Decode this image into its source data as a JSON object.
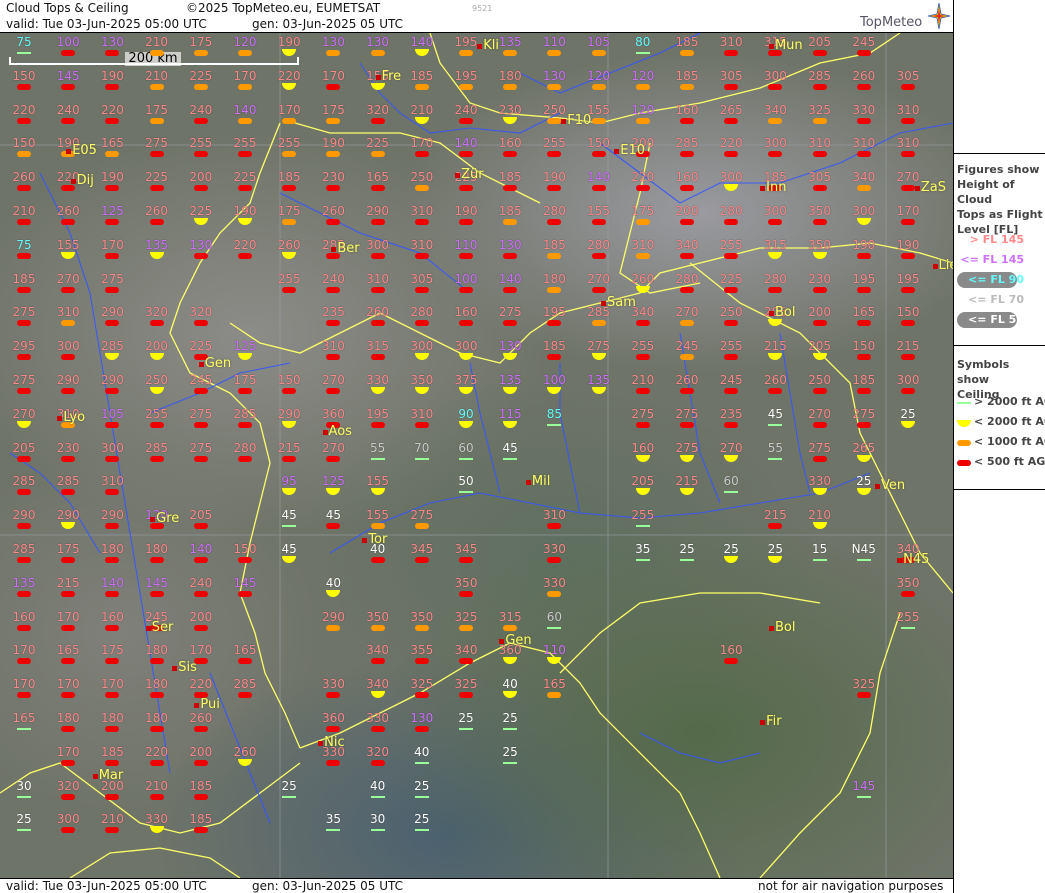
{
  "header": {
    "product": "Cloud Tops & Ceiling",
    "copyright": "©2025 TopMeteo.eu, EUMETSAT",
    "run_id": "9521",
    "valid": "valid:  Tue   03-Jun-2025   05:00 UTC",
    "generated": "gen: 03-Jun-2025 05 UTC",
    "logo": "TopMeteo"
  },
  "footer": {
    "valid": "valid:  Tue   03-Jun-2025   05:00 UTC",
    "generated": "gen: 03-Jun-2025 05 UTC",
    "disclaimer": "not for air navigation purposes"
  },
  "scale_bar": {
    "label": "200 km"
  },
  "legend": {
    "tops_title": [
      "Figures show",
      "Height of Cloud",
      "Tops as Flight",
      "Level  [FL]"
    ],
    "tops_classes": [
      {
        "label": "> FL 145",
        "color": "#ff8a8a",
        "pill": false
      },
      {
        "label": "<= FL 145",
        "color": "#d070ff",
        "pill": false
      },
      {
        "label": "<= FL 90",
        "color": "#66ffff",
        "pill": true
      },
      {
        "label": "<= FL 70",
        "color": "#bbbbbb",
        "pill": false
      },
      {
        "label": "<= FL 50",
        "color": "#ffffff",
        "pill": true
      }
    ],
    "ceiling_title": [
      "Symbols show",
      "Ceiling"
    ],
    "ceiling_classes": [
      {
        "label": "> 2000 ft AGL",
        "symbol": "line",
        "color": "#99ff99"
      },
      {
        "label": "< 2000 ft AGL",
        "symbol": "half-circle",
        "color": "#ffff00"
      },
      {
        "label": "< 1000 ft AGL",
        "symbol": "bar",
        "color": "#ff9900"
      },
      {
        "label": "< 500 ft AGL",
        "symbol": "bar",
        "color": "#ee0000"
      }
    ]
  },
  "colors": {
    "above_145": "#ff8a8a",
    "le_145": "#d070ff",
    "le_90": "#66ffff",
    "le_70": "#cccccc",
    "le_50": "#ffffff",
    "ceil_line": "#99ff99",
    "ceil_half": "#ffff00",
    "ceil_orange": "#ff9900",
    "ceil_red": "#ee0000",
    "city": "#ffff66",
    "border": "#ffff66",
    "river": "#3355ff"
  },
  "grid": {
    "columns": 22,
    "rows": 24,
    "rows_data": [
      [
        "75 l",
        "100 r",
        "130 r",
        "210 o",
        "175 o",
        "120 o",
        "190 y",
        "130 o",
        "130 o",
        "140 y",
        "195 o",
        "135 o",
        "110 o",
        "105 o",
        "80 l",
        "185 o",
        "310 r",
        "315 r",
        "205 r",
        "245 r",
        null,
        null
      ],
      [
        "150 r",
        "145 r",
        "190 r",
        "210 o",
        "225 o",
        "170 o",
        "220 y",
        "170 r",
        "155 y",
        "185 o",
        "195 o",
        "180 o",
        "130 o",
        "120 o",
        "120 o",
        "185 o",
        "305 r",
        "300 r",
        "285 r",
        "260 r",
        "305 r",
        null
      ],
      [
        "220 r",
        "240 r",
        "220 r",
        "175 o",
        "240 r",
        "140 o",
        "170 o",
        "175 o",
        "320 r",
        "210 y",
        "240 r",
        "230 y",
        "250 o",
        "155 o",
        "120 o",
        "160 r",
        "265 r",
        "340 o",
        "325 o",
        "330 r",
        "310 r",
        null
      ],
      [
        "150 o",
        "190 o",
        "165 o",
        "275 r",
        "255 r",
        "255 r",
        "255 o",
        "190 o",
        "225 o",
        "170 r",
        "140 r",
        "160 r",
        "255 r",
        "150 r",
        "200 r",
        "285 r",
        "220 r",
        "300 r",
        "310 r",
        "310 r",
        "310 r",
        null
      ],
      [
        "260 r",
        "220 r",
        "190 r",
        "225 r",
        "200 r",
        "225 r",
        "185 r",
        "230 r",
        "165 r",
        "250 o",
        "225 r",
        "185 r",
        "190 r",
        "140 r",
        "220 r",
        "160 r",
        "300 y",
        "185 r",
        "305 r",
        "340 o",
        "270 r",
        null
      ],
      [
        "210 r",
        "260 r",
        "125 r",
        "260 r",
        "225 y",
        "190 y",
        "175 o",
        "260 r",
        "290 r",
        "310 r",
        "190 r",
        "185 o",
        "280 r",
        "155 r",
        "175 o",
        "200 r",
        "280 r",
        "300 r",
        "350 r",
        "300 y",
        "170 r",
        null
      ],
      [
        "75 r",
        "155 y",
        "170 r",
        "135 y",
        "130 r",
        "220 r",
        "260 y",
        "285 r",
        "300 r",
        "310 r",
        "110 r",
        "130 r",
        "185 o",
        "280 r",
        "310 o",
        "340 r",
        "255 r",
        "315 y",
        "350 y",
        "190 r",
        "190 r",
        null
      ],
      [
        "185 r",
        "270 r",
        "275 r",
        null,
        null,
        null,
        "255 r",
        "240 r",
        "310 r",
        "305 r",
        "100 r",
        "140 r",
        "180 o",
        "270 r",
        "260 y",
        "280 r",
        "225 r",
        "280 r",
        "230 r",
        "195 r",
        "195 r",
        null
      ],
      [
        "275 r",
        "310 o",
        "290 r",
        "320 r",
        "320 r",
        null,
        null,
        "235 r",
        "260 r",
        "280 r",
        "160 r",
        "275 r",
        "195 r",
        "285 o",
        "340 r",
        "270 o",
        "250 r",
        "205 y",
        "200 r",
        "165 r",
        "150 r",
        null
      ],
      [
        "295 r",
        "300 r",
        "285 y",
        "200 y",
        "225 r",
        "125 y",
        null,
        "310 r",
        "315 r",
        "300 y",
        "300 y",
        "130 y",
        "185 r",
        "275 y",
        "255 r",
        "245 o",
        "255 r",
        "215 y",
        "205 y",
        "150 r",
        "215 r",
        null
      ],
      [
        "275 r",
        "290 r",
        "290 r",
        "250 y",
        "245 r",
        "175 r",
        "150 r",
        "270 r",
        "330 y",
        "350 y",
        "375 y",
        "135 y",
        "100 y",
        "135 y",
        "210 r",
        "260 r",
        "245 r",
        "260 r",
        "250 r",
        "185 r",
        "300 r",
        null
      ],
      [
        "270 y",
        "310 o",
        "105 r",
        "255 r",
        "275 r",
        "285 r",
        "290 y",
        "360 r",
        "195 r",
        "310 r",
        "90 y",
        "115 y",
        "85 l",
        null,
        "275 r",
        "275 r",
        "235 r",
        "45 l",
        "270 r",
        "275 r",
        "25 y",
        null
      ],
      [
        "205 r",
        "230 r",
        "300 r",
        "285 r",
        "275 r",
        "280 r",
        "215 r",
        "270 r",
        "55 l",
        "70 l",
        "60 l",
        "45 l",
        null,
        null,
        "160 y",
        "275 y",
        "270 y",
        "55 l",
        "275 r",
        "265 y",
        null,
        null
      ],
      [
        "285 r",
        "285 r",
        "310 r",
        null,
        null,
        null,
        "95 y",
        "125 y",
        "155 y",
        null,
        "50 l",
        null,
        null,
        null,
        "205 y",
        "215 y",
        "60 l",
        null,
        "330 y",
        "25 y",
        null,
        null
      ],
      [
        "290 r",
        "290 y",
        "290 r",
        "120 r",
        "205 r",
        null,
        "45 l",
        "45 r",
        "155 o",
        "275 o",
        null,
        null,
        "310 r",
        null,
        "255 l",
        null,
        null,
        "215 r",
        "210 y",
        null,
        null,
        null
      ],
      [
        "285 r",
        "175 r",
        "180 r",
        "180 r",
        "140 r",
        "150 r",
        "45 y",
        null,
        "40 r",
        "345 r",
        "345 r",
        null,
        "330 r",
        null,
        "35 l",
        "25 l",
        "25 y",
        "25 y",
        "15 l",
        "N45 l",
        "340 r",
        null
      ],
      [
        "135 r",
        "215 r",
        "140 r",
        "145 r",
        "240 r",
        "145 r",
        null,
        "40 y",
        null,
        null,
        "350 r",
        null,
        "330 o",
        null,
        null,
        null,
        null,
        null,
        null,
        null,
        "350 r",
        null
      ],
      [
        "160 r",
        "170 r",
        "160 r",
        "245 r",
        "200 r",
        null,
        null,
        "290 o",
        "350 o",
        "350 o",
        "325 o",
        "315 o",
        "60 l",
        null,
        null,
        null,
        null,
        null,
        null,
        null,
        "255 l",
        null
      ],
      [
        "170 r",
        "165 r",
        "175 r",
        "180 r",
        "170 r",
        "165 r",
        null,
        null,
        "340 r",
        "355 r",
        "340 r",
        "360 y",
        "110 y",
        null,
        null,
        null,
        "160 r",
        null,
        null,
        null,
        null,
        null
      ],
      [
        "170 r",
        "170 r",
        "170 r",
        "180 r",
        "220 r",
        "285 r",
        null,
        "330 r",
        "340 y",
        "325 r",
        "325 r",
        "40 y",
        "165 o",
        null,
        null,
        null,
        null,
        null,
        null,
        "325 r",
        null,
        null
      ],
      [
        "165 l",
        "180 r",
        "180 r",
        "180 r",
        "260 r",
        null,
        null,
        "360 r",
        "330 r",
        "130 r",
        "25 l",
        "25 l",
        null,
        null,
        null,
        null,
        null,
        null,
        null,
        null,
        null,
        null
      ],
      [
        null,
        "170 r",
        "185 r",
        "220 r",
        "200 r",
        "260 y",
        null,
        "330 r",
        "320 r",
        "40 l",
        null,
        "25 l",
        null,
        null,
        null,
        null,
        null,
        null,
        null,
        null,
        null,
        null
      ],
      [
        "30 l",
        "320 r",
        "200 r",
        "210 r",
        "185 r",
        null,
        "25 l",
        null,
        "40 l",
        "25 l",
        null,
        null,
        null,
        null,
        null,
        null,
        null,
        null,
        null,
        "145 l",
        null,
        null
      ],
      [
        "25 l",
        "300 r",
        "210 r",
        "330 y",
        "185 r",
        null,
        null,
        "35 l",
        "30 l",
        "25 l",
        null,
        null,
        null,
        null,
        null,
        null,
        null,
        null,
        null,
        null,
        null,
        null
      ]
    ]
  },
  "cities": [
    {
      "name": "Fre",
      "col": 8.0,
      "row": 0.7
    },
    {
      "name": "Kli",
      "col": 10.3,
      "row": -0.2
    },
    {
      "name": "Mun",
      "col": 16.9,
      "row": -0.2
    },
    {
      "name": "F10",
      "col": 12.2,
      "row": 2.0
    },
    {
      "name": "E05",
      "col": 1.0,
      "row": 2.9
    },
    {
      "name": "E10",
      "col": 13.4,
      "row": 2.9
    },
    {
      "name": "Dij",
      "col": 1.1,
      "row": 3.8
    },
    {
      "name": "Zür",
      "col": 9.8,
      "row": 3.6
    },
    {
      "name": "Inn",
      "col": 16.7,
      "row": 4.0
    },
    {
      "name": "ZaS",
      "col": 20.2,
      "row": 4.0
    },
    {
      "name": "Ber",
      "col": 7.0,
      "row": 5.8
    },
    {
      "name": "Lie",
      "col": 20.6,
      "row": 6.3
    },
    {
      "name": "Sam",
      "col": 13.1,
      "row": 7.4
    },
    {
      "name": "Bol",
      "col": 16.9,
      "row": 7.7
    },
    {
      "name": "Gen",
      "col": 4.0,
      "row": 9.2
    },
    {
      "name": "Lyo",
      "col": 0.8,
      "row": 10.8
    },
    {
      "name": "Aos",
      "col": 6.8,
      "row": 11.2
    },
    {
      "name": "Mil",
      "col": 11.4,
      "row": 12.7
    },
    {
      "name": "Ven",
      "col": 19.3,
      "row": 12.8
    },
    {
      "name": "Gre",
      "col": 2.9,
      "row": 13.8
    },
    {
      "name": "Tor",
      "col": 7.7,
      "row": 14.4
    },
    {
      "name": "N45",
      "col": 19.8,
      "row": 15.0
    },
    {
      "name": "Ser",
      "col": 2.8,
      "row": 17.0
    },
    {
      "name": "Gen",
      "col": 10.8,
      "row": 17.4
    },
    {
      "name": "Bol",
      "col": 16.9,
      "row": 17.0
    },
    {
      "name": "Sis",
      "col": 3.4,
      "row": 18.2
    },
    {
      "name": "Pui",
      "col": 3.9,
      "row": 19.3
    },
    {
      "name": "Nic",
      "col": 6.7,
      "row": 20.4
    },
    {
      "name": "Fir",
      "col": 16.7,
      "row": 19.8
    },
    {
      "name": "Mar",
      "col": 1.6,
      "row": 21.4
    }
  ]
}
